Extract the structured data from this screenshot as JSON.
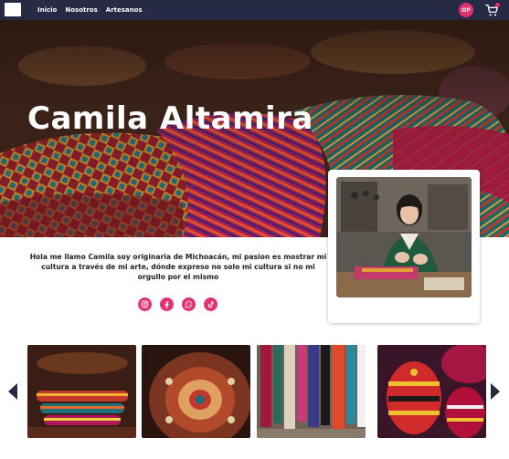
{
  "navbar": {
    "links": [
      "Inicio",
      "Nosotros",
      "Artesanos"
    ],
    "avatar_initials": "OP",
    "cart_icon": "cart-icon"
  },
  "hero": {
    "title": "Camila Altamira"
  },
  "intro": {
    "text": "Hola me llamo Camila soy originaria de Michoacán, mi pasion es mostrar mi cultura a través de mi arte, dónde expreso no solo mi cultura si no mi orgullo por el mismo"
  },
  "socials": [
    "instagram-icon",
    "facebook-icon",
    "whatsapp-icon",
    "tiktok-icon"
  ],
  "colors": {
    "navbar": "#262a45",
    "accent": "#e0336e"
  }
}
